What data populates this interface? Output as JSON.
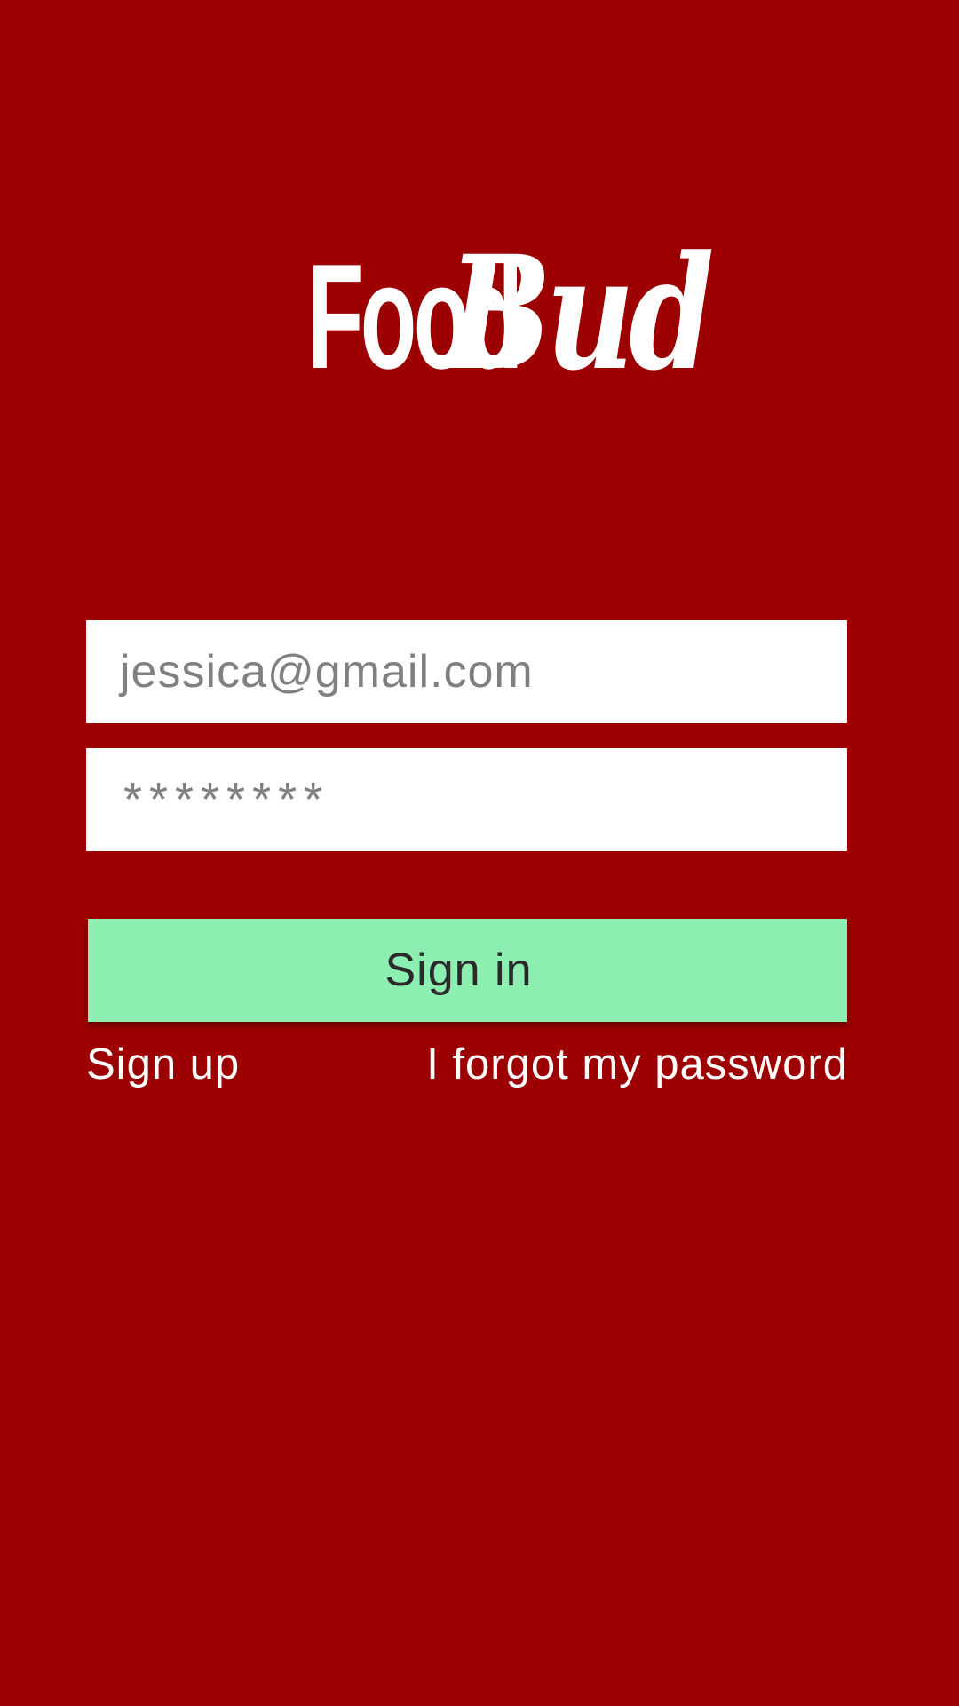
{
  "app": {
    "logo_part1": "Food",
    "logo_part2": "Bud"
  },
  "login": {
    "email_value": "jessica@gmail.com",
    "password_value": "********",
    "signin_label": "Sign in",
    "signup_label": "Sign up",
    "forgot_label": "I forgot my password"
  },
  "colors": {
    "background": "#9c0000",
    "button": "#8ceeb0",
    "field": "#ffffff",
    "field_text": "#808080"
  }
}
